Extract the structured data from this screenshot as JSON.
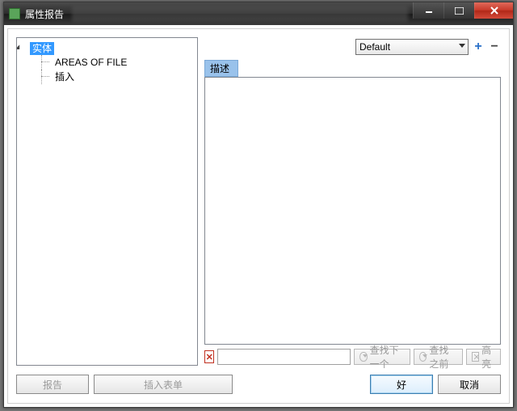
{
  "window": {
    "title": "属性报告"
  },
  "tree": {
    "root_label": "实体",
    "children": [
      {
        "label": "AREAS OF FILE"
      },
      {
        "label": "插入"
      }
    ]
  },
  "combo": {
    "selected": "Default"
  },
  "description": {
    "header": "描述"
  },
  "search": {
    "value": "",
    "placeholder": "",
    "find_next": "查找下一个",
    "find_prev": "查找之前",
    "highlight": "高亮"
  },
  "buttons": {
    "report": "报告",
    "insert_form": "插入表单",
    "ok": "好",
    "cancel": "取消"
  }
}
